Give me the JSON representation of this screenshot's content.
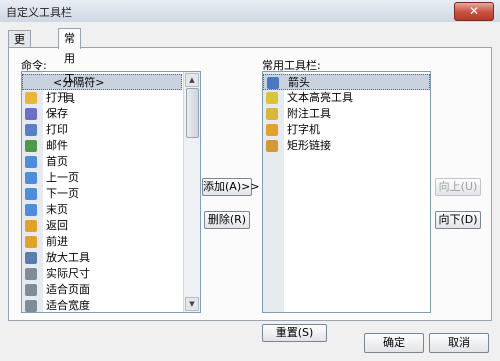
{
  "window": {
    "title": "自定义工具栏",
    "close_glyph": "✕"
  },
  "tabs": [
    {
      "label": "更多工具",
      "active": false
    },
    {
      "label": "常用工具",
      "active": true
    }
  ],
  "commands": {
    "label": "命令:",
    "items": [
      {
        "label": "<分隔符>",
        "icon": "none",
        "color": "",
        "selected": true
      },
      {
        "label": "打开",
        "icon": "folder-icon",
        "color": "#e8b73a"
      },
      {
        "label": "保存",
        "icon": "save-icon",
        "color": "#6b6fc6"
      },
      {
        "label": "打印",
        "icon": "print-icon",
        "color": "#5b7ec9"
      },
      {
        "label": "邮件",
        "icon": "email-icon",
        "color": "#4f9a4a"
      },
      {
        "label": "首页",
        "icon": "first-page-icon",
        "color": "#4c8ed8"
      },
      {
        "label": "上一页",
        "icon": "previous-page-icon",
        "color": "#4c8ed8"
      },
      {
        "label": "下一页",
        "icon": "next-page-icon",
        "color": "#4c8ed8"
      },
      {
        "label": "末页",
        "icon": "last-page-icon",
        "color": "#4c8ed8"
      },
      {
        "label": "返回",
        "icon": "back-arrow-icon",
        "color": "#e0a22b"
      },
      {
        "label": "前进",
        "icon": "forward-arrow-icon",
        "color": "#e0a22b"
      },
      {
        "label": "放大工具",
        "icon": "zoom-icon",
        "color": "#5a7cae"
      },
      {
        "label": "实际尺寸",
        "icon": "actual-size-icon",
        "color": "#7f8c99"
      },
      {
        "label": "适合页面",
        "icon": "fit-page-icon",
        "color": "#7f8c99"
      },
      {
        "label": "适合宽度",
        "icon": "fit-width-icon",
        "color": "#7f8c99"
      }
    ]
  },
  "toolbar_list": {
    "label": "常用工具栏:",
    "items": [
      {
        "label": "箭头",
        "icon": "arrow-cursor-icon",
        "color": "#4a78c2",
        "selected": true
      },
      {
        "label": "文本高亮工具",
        "icon": "highlight-icon",
        "color": "#d9c43a"
      },
      {
        "label": "附注工具",
        "icon": "note-icon",
        "color": "#d8b63c"
      },
      {
        "label": "打字机",
        "icon": "typewriter-icon",
        "color": "#e0a22b"
      },
      {
        "label": "矩形链接",
        "icon": "rect-link-icon",
        "color": "#d49a3a"
      }
    ]
  },
  "buttons": {
    "add": "添加(A)>>",
    "delete": "删除(R)",
    "up": "向上(U)",
    "down": "向下(D)",
    "reset": "重置(S)",
    "ok": "确定",
    "cancel": "取消"
  },
  "scroll_arrows": {
    "up": "▲",
    "down": "▼"
  }
}
